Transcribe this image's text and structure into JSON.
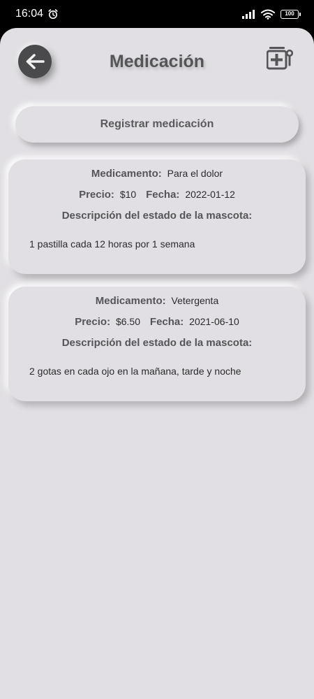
{
  "status_bar": {
    "time": "16:04",
    "battery": "100"
  },
  "header": {
    "title": "Medicación"
  },
  "actions": {
    "register_label": "Registrar medicación"
  },
  "labels": {
    "medication": "Medicamento:",
    "price": "Precio:",
    "date": "Fecha:",
    "description": "Descripción del estado de la mascota:"
  },
  "cards": [
    {
      "medication": "Para el dolor",
      "price": "$10",
      "date": "2022-01-12",
      "description": "1 pastilla cada 12 horas por 1 semana"
    },
    {
      "medication": "Vetergenta",
      "price": "$6.50",
      "date": "2021-06-10",
      "description": "2 gotas en cada ojo en la mañana, tarde y noche"
    }
  ]
}
